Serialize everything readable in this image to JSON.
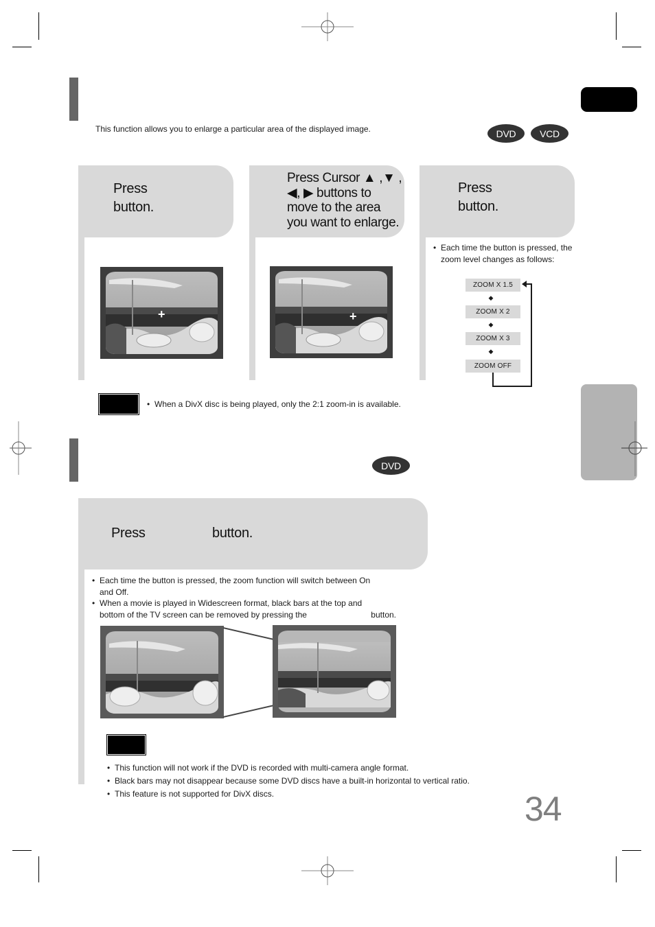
{
  "zoom_section": {
    "intro": "This function allows you to enlarge a particular area of the displayed image.",
    "badges": [
      "DVD",
      "VCD"
    ],
    "steps": [
      {
        "line1": "Press",
        "line2": "button."
      },
      {
        "lines": [
          "Press Cursor ▲ ,▼ ,",
          "◀, ▶ buttons to",
          "move to the area",
          "you want to enlarge."
        ]
      },
      {
        "line1": "Press",
        "line2": "button."
      }
    ],
    "step3_bullet": [
      "Each time the button is pressed, the",
      "zoom level changes as follows:"
    ],
    "zoom_levels": [
      "ZOOM  X 1.5",
      "ZOOM  X 2",
      "ZOOM  X 3",
      "ZOOM  OFF"
    ],
    "note": "When a DivX disc is being played, only the 2:1 zoom-in is available.",
    "cursor_symbol": "+"
  },
  "aspect_section": {
    "badge": "DVD",
    "step": {
      "press": "Press",
      "button": "button."
    },
    "bullets": [
      {
        "line1": "Each time the button is pressed, the zoom function will switch between On",
        "line2": "and Off."
      },
      {
        "line1": "When a movie is played in Widescreen format, black bars at the top and",
        "line2": "bottom of the TV screen can be removed by pressing the",
        "line2_end": "button."
      }
    ],
    "notes": [
      "This function will not work if the DVD is recorded with multi-camera angle format.",
      "Black bars may not disappear because some DVD discs have a built-in horizontal to vertical ratio.",
      "This feature is not supported for DivX discs."
    ]
  },
  "page_number": "34",
  "icons": {
    "registration_mark": "crosshair-circle-icon",
    "flow_arrow": "down-arrow-icon"
  }
}
